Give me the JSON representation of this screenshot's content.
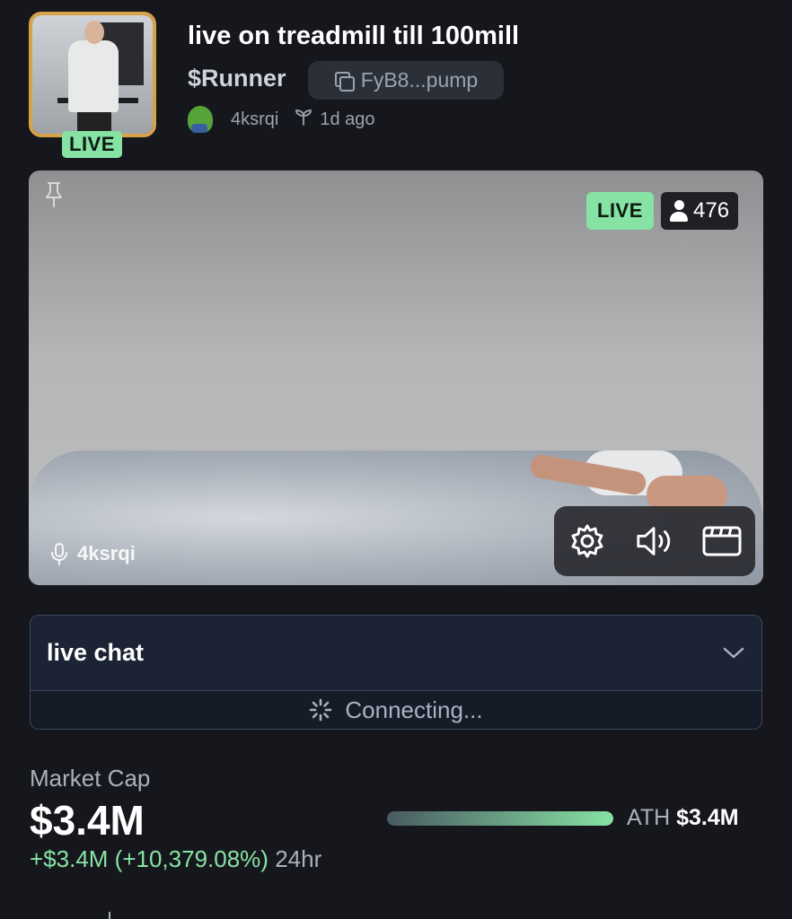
{
  "stream": {
    "title": "live on treadmill till 100mill",
    "ticker": "$Runner",
    "contract_short": "FyB8...pump",
    "creator": "4ksrqi",
    "age": "1d ago",
    "thumb_live": "LIVE"
  },
  "video": {
    "live_label": "LIVE",
    "viewers": "476",
    "streamer": "4ksrqi"
  },
  "chat": {
    "title": "live chat",
    "status": "Connecting..."
  },
  "market": {
    "label": "Market Cap",
    "value": "$3.4M",
    "change": "+$3.4M (+10,379.08%)",
    "period": "24hr",
    "ath_label": "ATH",
    "ath_value": "$3.4M",
    "ath_progress": 1.0
  },
  "colors": {
    "accent_green": "#86e3a4",
    "thumb_border": "#d7a24a",
    "background": "#16171c"
  }
}
